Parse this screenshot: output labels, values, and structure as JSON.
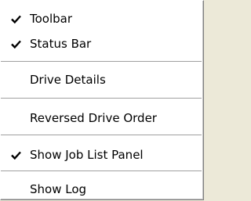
{
  "menu": {
    "items": [
      {
        "label": "Toolbar",
        "checked": true,
        "icon": "checkmark-icon"
      },
      {
        "label": "Status Bar",
        "checked": true,
        "icon": "checkmark-icon"
      },
      {
        "label": "Drive Details",
        "checked": false
      },
      {
        "label": "Reversed Drive Order",
        "checked": false
      },
      {
        "label": "Show Job List Panel",
        "checked": true,
        "icon": "checkmark-icon"
      },
      {
        "label": "Show Log",
        "checked": false
      }
    ]
  },
  "colors": {
    "menu_bg": "#ffffff",
    "text": "#000000",
    "separator": "#a0a0a0"
  }
}
